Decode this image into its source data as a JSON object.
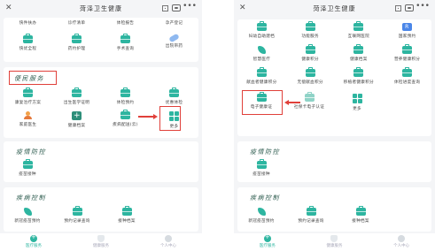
{
  "colors": {
    "accent": "#2db5a0",
    "annotation_red": "#e0403a",
    "background": "#f4f5f7"
  },
  "left": {
    "title": "菏泽卫生健康",
    "top_row": [
      "快件扶办",
      "诊疗清单",
      "体检报告",
      "孕产登记"
    ],
    "second_row": [
      "快优全程",
      "药约护理",
      "手术查询",
      "出院带药"
    ],
    "convenience": {
      "title": "便民服务",
      "row1": [
        "康复治疗方案",
        "出生医学证明",
        "体检预约",
        "优惠体检"
      ],
      "row2": [
        "家庭医生",
        "健康档案",
        "疾病配送(云)",
        "更多"
      ]
    },
    "epidemic": {
      "title": "疫情防控",
      "items": [
        "疫苗接种"
      ]
    },
    "disease": {
      "title": "疾病控制",
      "items": [
        "新冠疫苗预约",
        "预约记录查询",
        "接种档案"
      ]
    },
    "nav": [
      "医疗服务",
      "健康服务",
      "个人中心"
    ]
  },
  "right": {
    "title": "菏泽卫生健康",
    "row1": [
      "妇幼自助建档",
      "功能服务",
      "互联网医院",
      "国家预约"
    ],
    "row2": [
      "智慧医疗",
      "健康积分",
      "健康档案",
      "营养健康积分"
    ],
    "row3": [
      "献血者健康积分",
      "无偿献血积分",
      "移植者健康积分",
      "体检进度查询"
    ],
    "row4": [
      "电子健康证",
      "社保卡电子认证",
      "更多"
    ],
    "epidemic": {
      "title": "疫情防控",
      "items": [
        "疫苗接种"
      ]
    },
    "disease": {
      "title": "疾病控制",
      "items": [
        "新冠疫苗预约",
        "预约记录查询",
        "接种档案"
      ]
    },
    "nav": [
      "医疗服务",
      "健康服务",
      "个人中心"
    ]
  }
}
